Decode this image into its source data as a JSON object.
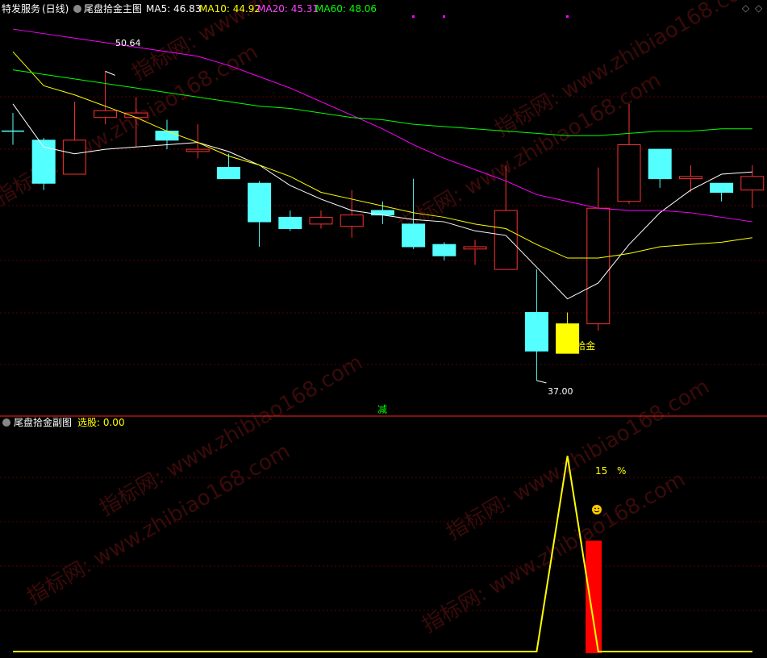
{
  "main_header": {
    "stock_name": "特发服务",
    "period": "(日线)",
    "indicator": "尾盘拾金主图",
    "ma_labels": [
      {
        "label": "MA5: 46.83",
        "color": "#ffffff"
      },
      {
        "label": "MA10: 44.92",
        "color": "#ffff00"
      },
      {
        "label": "MA20: 45.31",
        "color": "#ff00ff"
      },
      {
        "label": "MA60: 48.06",
        "color": "#00ff00"
      }
    ],
    "high_label": "50.64",
    "low_label": "37.00",
    "signal_label": "▲拾金",
    "jian_label": "减",
    "diamond_icon": "◇",
    "prev_icon": "◇"
  },
  "sub_header": {
    "indicator": "尾盘拾金副图",
    "xuangu": "选股: 0.00",
    "pct_num": "15",
    "pct_sign": "%",
    "smile_icon": "smiley-icon"
  },
  "chart_data": [
    {
      "type": "candlestick",
      "title": "尾盘拾金主图",
      "ylim": [
        36,
        53
      ],
      "candles": [
        {
          "o": 48.0,
          "h": 48.8,
          "l": 47.4,
          "c": 48.0
        },
        {
          "o": 47.6,
          "h": 47.7,
          "l": 45.4,
          "c": 45.7
        },
        {
          "o": 46.1,
          "h": 49.3,
          "l": 46.1,
          "c": 47.6
        },
        {
          "o": 48.6,
          "h": 50.64,
          "l": 48.3,
          "c": 48.9
        },
        {
          "o": 48.6,
          "h": 49.5,
          "l": 47.3,
          "c": 48.8
        },
        {
          "o": 48.0,
          "h": 48.5,
          "l": 47.2,
          "c": 47.6
        },
        {
          "o": 47.1,
          "h": 48.3,
          "l": 46.8,
          "c": 47.2
        },
        {
          "o": 46.4,
          "h": 47.0,
          "l": 45.9,
          "c": 45.9
        },
        {
          "o": 45.7,
          "h": 45.8,
          "l": 42.9,
          "c": 44.0
        },
        {
          "o": 44.2,
          "h": 44.5,
          "l": 43.6,
          "c": 43.7
        },
        {
          "o": 43.9,
          "h": 44.5,
          "l": 43.7,
          "c": 44.2
        },
        {
          "o": 43.8,
          "h": 45.4,
          "l": 43.3,
          "c": 44.3
        },
        {
          "o": 44.5,
          "h": 44.9,
          "l": 43.9,
          "c": 44.3
        },
        {
          "o": 43.9,
          "h": 45.9,
          "l": 42.8,
          "c": 42.9
        },
        {
          "o": 43.0,
          "h": 43.1,
          "l": 42.3,
          "c": 42.5
        },
        {
          "o": 42.8,
          "h": 43.2,
          "l": 42.1,
          "c": 42.9
        },
        {
          "o": 41.9,
          "h": 46.5,
          "l": 41.9,
          "c": 44.5
        },
        {
          "o": 40.0,
          "h": 41.9,
          "l": 37.0,
          "c": 38.3
        },
        {
          "o": 38.2,
          "h": 40.0,
          "l": 38.2,
          "c": 39.5
        },
        {
          "o": 39.5,
          "h": 46.4,
          "l": 39.2,
          "c": 44.6
        },
        {
          "o": 44.9,
          "h": 49.2,
          "l": 44.8,
          "c": 47.4
        },
        {
          "o": 47.2,
          "h": 47.2,
          "l": 45.5,
          "c": 45.9
        },
        {
          "o": 45.9,
          "h": 46.5,
          "l": 45.3,
          "c": 46.0
        },
        {
          "o": 45.7,
          "h": 45.7,
          "l": 44.9,
          "c": 45.3
        },
        {
          "o": 45.4,
          "h": 46.5,
          "l": 44.6,
          "c": 46.0
        }
      ],
      "series": [
        {
          "name": "MA5",
          "color": "#ffffff",
          "values": [
            49.2,
            47.3,
            47.0,
            47.2,
            47.3,
            47.4,
            47.5,
            47.1,
            46.5,
            45.6,
            45.0,
            44.5,
            44.3,
            44.1,
            44.0,
            43.6,
            43.4,
            42.0,
            40.6,
            41.3,
            43.0,
            44.4,
            45.4,
            46.1,
            46.2
          ]
        },
        {
          "name": "MA10",
          "color": "#ffff00",
          "values": [
            51.5,
            50.0,
            49.6,
            49.1,
            48.6,
            48.0,
            47.5,
            46.9,
            46.5,
            46.0,
            45.3,
            45.0,
            44.7,
            44.4,
            44.2,
            43.9,
            43.7,
            43.0,
            42.4,
            42.4,
            42.6,
            42.9,
            43.0,
            43.1,
            43.3
          ]
        },
        {
          "name": "MA20",
          "color": "#ff00ff",
          "values": [
            52.5,
            52.3,
            52.1,
            51.9,
            51.7,
            51.5,
            51.3,
            50.9,
            50.4,
            49.9,
            49.3,
            48.7,
            48.1,
            47.4,
            46.8,
            46.3,
            45.8,
            45.2,
            44.9,
            44.6,
            44.5,
            44.5,
            44.4,
            44.2,
            44.0
          ]
        },
        {
          "name": "MA60",
          "color": "#00ff00",
          "values": [
            50.7,
            50.5,
            50.3,
            50.1,
            49.9,
            49.7,
            49.5,
            49.3,
            49.1,
            49.0,
            48.8,
            48.6,
            48.5,
            48.3,
            48.2,
            48.1,
            48.0,
            47.9,
            47.8,
            47.8,
            47.9,
            48.0,
            48.0,
            48.1,
            48.1
          ]
        }
      ]
    },
    {
      "type": "line",
      "title": "尾盘拾金副图",
      "ylim": [
        0,
        17
      ],
      "series": [
        {
          "name": "选股",
          "color": "#ffff00",
          "values": [
            0,
            0,
            0,
            0,
            0,
            0,
            0,
            0,
            0,
            0,
            0,
            0,
            0,
            0,
            0,
            0,
            0,
            0,
            15,
            0,
            0,
            0,
            0,
            0,
            0
          ]
        }
      ],
      "bars": [
        {
          "index": 18.85,
          "value": 8.5,
          "color": "#ff0000"
        }
      ]
    }
  ]
}
